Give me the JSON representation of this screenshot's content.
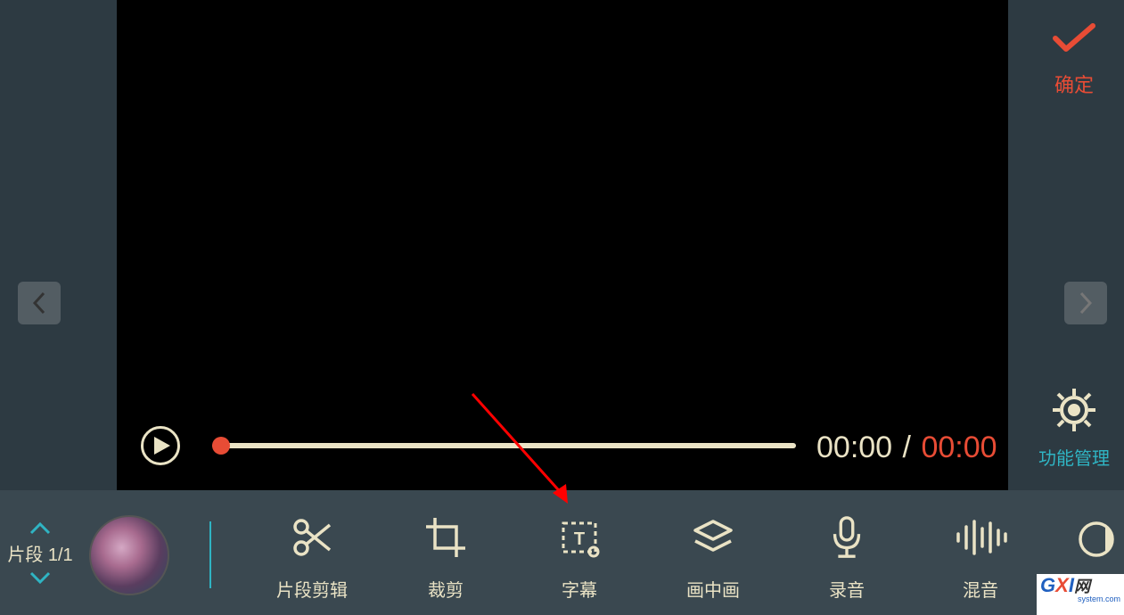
{
  "confirm": {
    "label": "确定"
  },
  "settings": {
    "label": "功能管理"
  },
  "time": {
    "current": "00:00",
    "total": "00:00"
  },
  "segment": {
    "label": "片段 1/1"
  },
  "tools": {
    "clip_edit": "片段剪辑",
    "crop": "裁剪",
    "subtitle": "字幕",
    "pip": "画中画",
    "record": "录音",
    "mix": "混音"
  },
  "watermark": {
    "brand_g": "G",
    "brand_x": "X",
    "brand_i": "I",
    "brand_net": "网",
    "domain": "system.com"
  }
}
